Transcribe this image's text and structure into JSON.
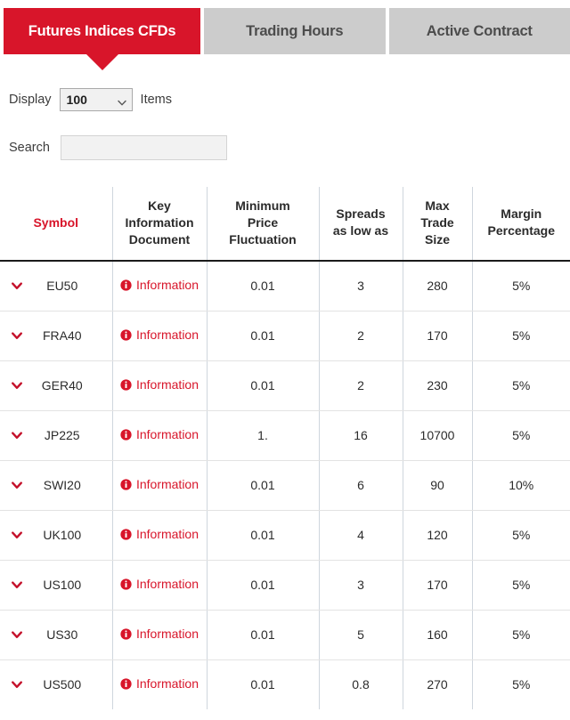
{
  "tabs": [
    {
      "label": "Futures Indices CFDs",
      "active": true
    },
    {
      "label": "Trading Hours",
      "active": false
    },
    {
      "label": "Active Contract",
      "active": false
    }
  ],
  "controls": {
    "display_label": "Display",
    "display_value": "100",
    "display_options": [
      "100"
    ],
    "items_label": "Items",
    "search_label": "Search",
    "search_value": "",
    "search_placeholder": ""
  },
  "colors": {
    "accent_red": "#d8152a",
    "tab_inactive": "#cccccc",
    "header_rule": "#1a1a1a",
    "cell_divider": "#cfd6dd"
  },
  "table": {
    "columns": [
      "Symbol",
      "Key Information Document",
      "Minimum Price Fluctuation",
      "Spreads as low as",
      "Max Trade Size",
      "Margin Percentage"
    ],
    "columns_lines": [
      [
        "Symbol"
      ],
      [
        "Key",
        "Information",
        "Document"
      ],
      [
        "Minimum",
        "Price",
        "Fluctuation"
      ],
      [
        "Spreads",
        "as low as"
      ],
      [
        "Max",
        "Trade",
        "Size"
      ],
      [
        "Margin",
        "Percentage"
      ]
    ],
    "info_link_label": "Information",
    "expand_icon": "chevron-down-icon",
    "rows": [
      {
        "symbol": "EU50",
        "kid": "Information",
        "min_price_fluctuation": "0.01",
        "spread": "3",
        "max_trade_size": "280",
        "margin_percentage": "5%"
      },
      {
        "symbol": "FRA40",
        "kid": "Information",
        "min_price_fluctuation": "0.01",
        "spread": "2",
        "max_trade_size": "170",
        "margin_percentage": "5%"
      },
      {
        "symbol": "GER40",
        "kid": "Information",
        "min_price_fluctuation": "0.01",
        "spread": "2",
        "max_trade_size": "230",
        "margin_percentage": "5%"
      },
      {
        "symbol": "JP225",
        "kid": "Information",
        "min_price_fluctuation": "1.",
        "spread": "16",
        "max_trade_size": "10700",
        "margin_percentage": "5%"
      },
      {
        "symbol": "SWI20",
        "kid": "Information",
        "min_price_fluctuation": "0.01",
        "spread": "6",
        "max_trade_size": "90",
        "margin_percentage": "10%"
      },
      {
        "symbol": "UK100",
        "kid": "Information",
        "min_price_fluctuation": "0.01",
        "spread": "4",
        "max_trade_size": "120",
        "margin_percentage": "5%"
      },
      {
        "symbol": "US100",
        "kid": "Information",
        "min_price_fluctuation": "0.01",
        "spread": "3",
        "max_trade_size": "170",
        "margin_percentage": "5%"
      },
      {
        "symbol": "US30",
        "kid": "Information",
        "min_price_fluctuation": "0.01",
        "spread": "5",
        "max_trade_size": "160",
        "margin_percentage": "5%"
      },
      {
        "symbol": "US500",
        "kid": "Information",
        "min_price_fluctuation": "0.01",
        "spread": "0.8",
        "max_trade_size": "270",
        "margin_percentage": "5%"
      }
    ]
  }
}
